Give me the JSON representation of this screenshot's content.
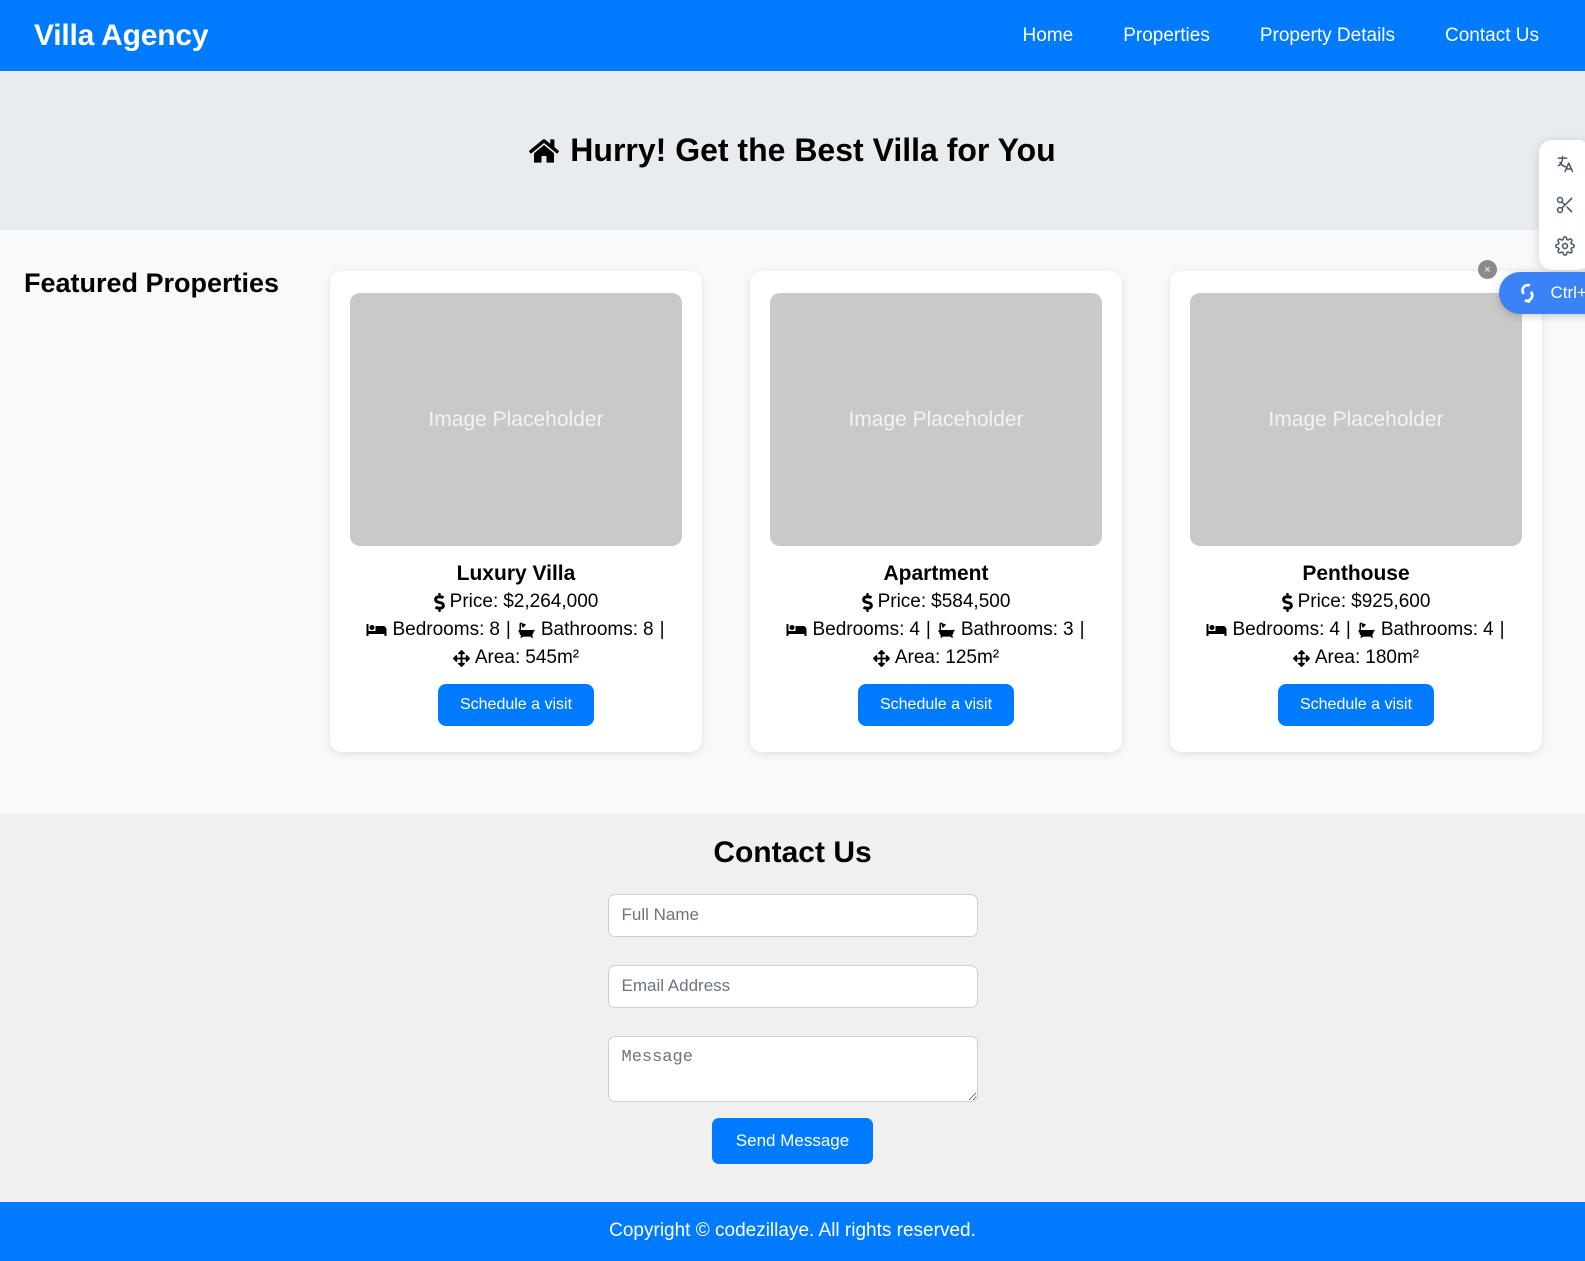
{
  "navbar": {
    "brand": "Villa Agency",
    "links": [
      {
        "label": "Home"
      },
      {
        "label": "Properties"
      },
      {
        "label": "Property Details"
      },
      {
        "label": "Contact Us"
      }
    ]
  },
  "hero": {
    "icon": "house-icon",
    "title": "Hurry! Get the Best Villa for You"
  },
  "featured": {
    "heading": "Featured Properties",
    "placeholder_label": "Image Placeholder",
    "cta_label": "Schedule a visit",
    "labels": {
      "price": "Price:",
      "bedrooms": "Bedrooms:",
      "bathrooms": "Bathrooms:",
      "area": "Area:",
      "separator": "|"
    },
    "cards": [
      {
        "name": "Luxury Villa",
        "price": "$2,264,000",
        "bedrooms": "8",
        "bathrooms": "8",
        "area": "545m²"
      },
      {
        "name": "Apartment",
        "price": "$584,500",
        "bedrooms": "4",
        "bathrooms": "3",
        "area": "125m²"
      },
      {
        "name": "Penthouse",
        "price": "$925,600",
        "bedrooms": "4",
        "bathrooms": "4",
        "area": "180m²"
      }
    ]
  },
  "contact": {
    "title": "Contact Us",
    "fields": {
      "name_placeholder": "Full Name",
      "name_value": "",
      "email_placeholder": "Email Address",
      "email_value": "",
      "message_placeholder": "Message",
      "message_value": ""
    },
    "submit_label": "Send Message"
  },
  "footer": {
    "text": "Copyright © codezillaye. All rights reserved."
  },
  "extension_overlay": {
    "icons": [
      {
        "name": "translate-icon"
      },
      {
        "name": "scissors-icon"
      },
      {
        "name": "gear-icon"
      }
    ],
    "pill_label": "Ctrl+M",
    "close_label": "×"
  },
  "colors": {
    "primary": "#007bff",
    "hero_bg": "#e9ecef",
    "featured_bg": "#f8f9fa",
    "contact_bg": "#f0f0f0",
    "placeholder_bg": "#c9c9c9",
    "extension_blue": "#3b82f6"
  }
}
